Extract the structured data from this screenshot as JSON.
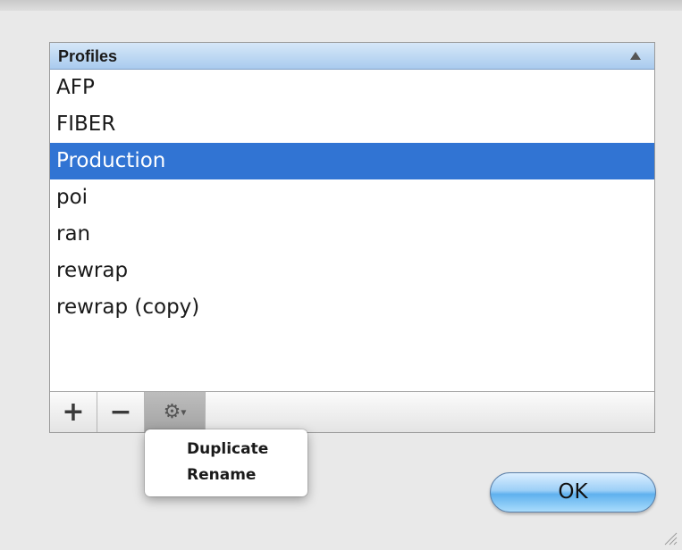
{
  "table": {
    "header": "Profiles",
    "sort_indicator": "ascending",
    "rows": [
      "AFP",
      "FIBER",
      "Production",
      "poi",
      "ran",
      "rewrap",
      "rewrap (copy)"
    ],
    "selected_row": "Production"
  },
  "toolbar": {
    "add_label": "+",
    "remove_label": "−",
    "action_label": "⚙",
    "action_caret": "▾"
  },
  "context_menu": {
    "items": [
      "Duplicate",
      "Rename"
    ]
  },
  "ok_button": {
    "label": "OK"
  },
  "colors": {
    "selection": "#3174d3",
    "header_gradient_top": "#d6e7f8",
    "header_gradient_bottom": "#a9cbee",
    "ok_button_accent": "#5fb1ee"
  }
}
